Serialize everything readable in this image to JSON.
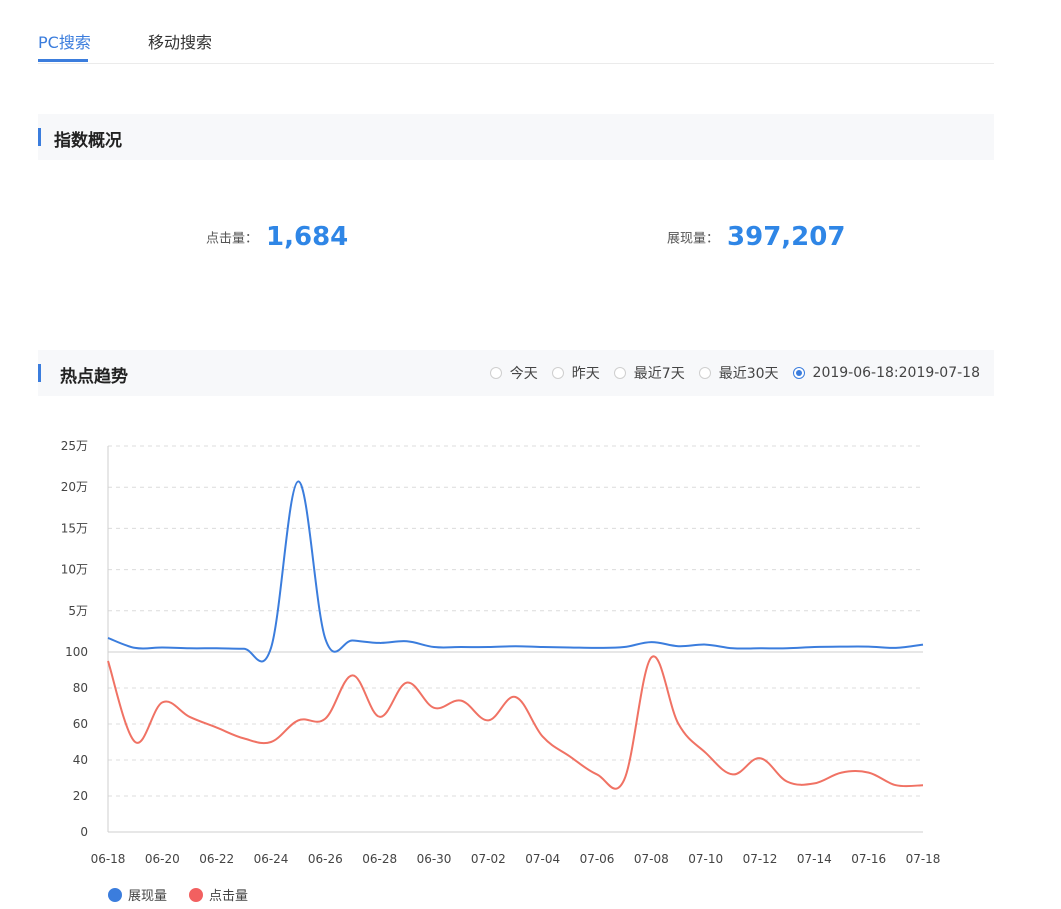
{
  "tabs": [
    {
      "label": "PC搜索",
      "active": true
    },
    {
      "label": "移动搜索",
      "active": false
    }
  ],
  "overview": {
    "title": "指数概况",
    "clicks_label": "点击量：",
    "clicks_value": "1,684",
    "impressions_label": "展现量：",
    "impressions_value": "397,207"
  },
  "trend": {
    "title": "热点趋势",
    "range_options": [
      {
        "label": "今天",
        "checked": false
      },
      {
        "label": "昨天",
        "checked": false
      },
      {
        "label": "最近7天",
        "checked": false
      },
      {
        "label": "最近30天",
        "checked": false
      },
      {
        "label": "2019-06-18:2019-07-18",
        "checked": true
      }
    ]
  },
  "colors": {
    "accent": "#3b7ddd",
    "impressions_line": "#3b7ddd",
    "clicks_line": "#f07264"
  },
  "chart_data": {
    "type": "line",
    "x": [
      "06-18",
      "06-19",
      "06-20",
      "06-21",
      "06-22",
      "06-23",
      "06-24",
      "06-25",
      "06-26",
      "06-27",
      "06-28",
      "06-29",
      "06-30",
      "07-01",
      "07-02",
      "07-03",
      "07-04",
      "07-05",
      "07-06",
      "07-07",
      "07-08",
      "07-09",
      "07-10",
      "07-11",
      "07-12",
      "07-13",
      "07-14",
      "07-15",
      "07-16",
      "07-17",
      "07-18"
    ],
    "x_tick_labels": [
      "06-18",
      "06-20",
      "06-22",
      "06-24",
      "06-26",
      "06-28",
      "06-30",
      "07-02",
      "07-04",
      "07-06",
      "07-08",
      "07-10",
      "07-12",
      "07-14",
      "07-16",
      "07-18"
    ],
    "series": [
      {
        "name": "展现量",
        "panel": "top",
        "values": [
          17000,
          5000,
          5500,
          4500,
          4500,
          4000,
          5000,
          207000,
          16000,
          14000,
          11000,
          13000,
          6000,
          6000,
          6000,
          7000,
          6000,
          5500,
          5000,
          6000,
          12000,
          7000,
          9000,
          4500,
          4500,
          4500,
          6000,
          6500,
          6500,
          5000,
          9000
        ]
      },
      {
        "name": "点击量",
        "panel": "bottom",
        "values": [
          95,
          50,
          72,
          64,
          58,
          52,
          50,
          62,
          63,
          87,
          64,
          83,
          69,
          73,
          62,
          75,
          53,
          42,
          32,
          29,
          97,
          60,
          44,
          32,
          41,
          28,
          27,
          33,
          33,
          26,
          26
        ]
      }
    ],
    "top_axis": {
      "ticks": [
        "5万",
        "10万",
        "15万",
        "20万",
        "25万"
      ],
      "tick_values": [
        50000,
        100000,
        150000,
        200000,
        250000
      ],
      "ylim": [
        0,
        250000
      ]
    },
    "bottom_axis": {
      "ticks": [
        "0",
        "20",
        "40",
        "60",
        "80",
        "100"
      ],
      "tick_values": [
        0,
        20,
        40,
        60,
        80,
        100
      ],
      "ylim": [
        0,
        100
      ]
    },
    "grid": true,
    "legend_position": "bottom-left"
  }
}
